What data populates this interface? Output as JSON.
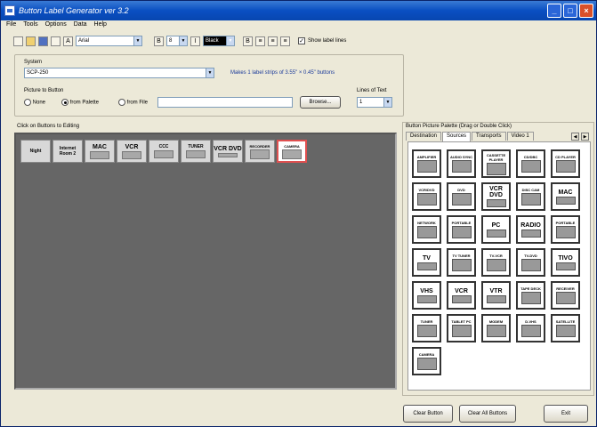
{
  "window": {
    "title": "Button Label Generator  ver 3.2"
  },
  "menu": [
    "File",
    "Tools",
    "Options",
    "Data",
    "Help"
  ],
  "toolbar": {
    "font": "Arial",
    "size": "8",
    "color": "Black",
    "show_label_lines_label": "Show label lines",
    "show_label_lines_checked": true
  },
  "system": {
    "group_label": "System",
    "selected": "SCP-250",
    "info": "Makes 1 label strips of 3.55\" × 0.45\" buttons"
  },
  "picture": {
    "group_label": "Picture to Button",
    "options": [
      "None",
      "from Palette",
      "from File"
    ],
    "selected_index": 1,
    "file_value": "",
    "browse_label": "Browse..."
  },
  "lines": {
    "group_label": "Lines of Text",
    "value": "1"
  },
  "edit": {
    "group_label": "Click on Buttons to Editing",
    "buttons": [
      {
        "text": "Night",
        "small": ""
      },
      {
        "text": "Internet Room 2",
        "small": ""
      },
      {
        "text": "MAC",
        "small": ""
      },
      {
        "text": "VCR",
        "small": ""
      },
      {
        "text": "CCC",
        "small": ""
      },
      {
        "text": "TUNER",
        "small": ""
      },
      {
        "text": "VCR DVD",
        "small": ""
      },
      {
        "text": "",
        "small": "RECORDER"
      },
      {
        "text": "",
        "small": "CAMERA"
      }
    ]
  },
  "palette": {
    "group_label": "Button Picture Palette (Drag or Double Click)",
    "tabs": [
      "Destination",
      "Sources",
      "Transports",
      "Video 1"
    ],
    "active_tab_index": 1,
    "buttons": [
      {
        "text": "",
        "small": "AMPLIFIER"
      },
      {
        "text": "",
        "small": "AUDIO SYNC"
      },
      {
        "text": "",
        "small": "CASSETTE PLAYER"
      },
      {
        "text": "",
        "small": "CD/DBC"
      },
      {
        "text": "",
        "small": "CD PLAYER"
      },
      {
        "text": "",
        "small": "VCR/DVD"
      },
      {
        "text": "",
        "small": "DVD"
      },
      {
        "text": "VCR DVD",
        "small": ""
      },
      {
        "text": "",
        "small": "DISC CAM"
      },
      {
        "text": "MAC",
        "small": ""
      },
      {
        "text": "",
        "small": "NETWORK"
      },
      {
        "text": "",
        "small": "PORTABLE"
      },
      {
        "text": "PC",
        "small": ""
      },
      {
        "text": "RADIO",
        "small": ""
      },
      {
        "text": "",
        "small": "PORTABLE"
      },
      {
        "text": "TV",
        "small": ""
      },
      {
        "text": "",
        "small": "TV TUNER"
      },
      {
        "text": "",
        "small": "TV-VCR"
      },
      {
        "text": "",
        "small": "TV-DVD"
      },
      {
        "text": "TIVO",
        "small": ""
      },
      {
        "text": "VHS",
        "small": ""
      },
      {
        "text": "VCR",
        "small": ""
      },
      {
        "text": "VTR",
        "small": ""
      },
      {
        "text": "",
        "small": "TAPE DECK"
      },
      {
        "text": "",
        "small": "RECEIVER"
      },
      {
        "text": "",
        "small": "TUNER"
      },
      {
        "text": "",
        "small": "TABLET PC"
      },
      {
        "text": "",
        "small": "MODEM"
      },
      {
        "text": "",
        "small": "D-VHS"
      },
      {
        "text": "",
        "small": "SATELLITE"
      },
      {
        "text": "",
        "small": "CAMERA"
      }
    ]
  },
  "footer": {
    "clear_button": "Clear Button",
    "clear_all_buttons": "Clear All Buttons",
    "exit": "Exit"
  }
}
